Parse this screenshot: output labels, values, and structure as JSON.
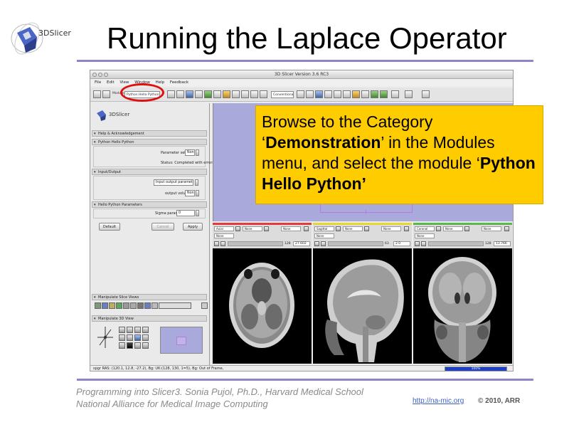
{
  "slide": {
    "title": "Running the Laplace Operator",
    "logo_text": "3DSlicer",
    "footer_line1": "Programming into Slicer3. Sonia Pujol, Ph.D., Harvard Medical School",
    "footer_line2": "National Alliance for Medical Image Computing",
    "footer_link": "http://na-mic.org",
    "footer_copyright": "© 2010, ARR"
  },
  "callout": {
    "part1": "Browse to the Category ‘",
    "bold1": "Demonstration",
    "part2": "’ in the Modules menu, and select the module ‘",
    "bold2": "Python Hello Python’"
  },
  "app": {
    "window_title": "3D Slicer Version 3.6 RC3",
    "menu": [
      "File",
      "Edit",
      "View",
      "Window",
      "Help",
      "Feedback"
    ],
    "toolbar": {
      "modules_label": "Modules",
      "module_selector_value": "Python Hello Python",
      "layout_field": "Conventional"
    },
    "left_panel": {
      "logo_text": "3DSlicer",
      "sections": {
        "help": "Help & Acknowledgement",
        "python_hello": "Python Hello Python",
        "io": "Input/Output",
        "params": "Hello Python Parameters",
        "slice_views": "Manipulate Slice Views",
        "view3d": "Manipulate 3D View"
      },
      "parameter_set_label": "Parameter set",
      "parameter_set_value": "None",
      "status_text": "Status: Completed with errors",
      "input_volume_value": "Input output parameter d",
      "output_volume_label": "output volume",
      "output_volume_value": "None",
      "sigma_label": "Sigma param",
      "sigma_value": "0",
      "buttons": {
        "default": "Default",
        "cancel": "Cancel",
        "apply": "Apply"
      }
    },
    "slices": [
      {
        "color": "#e03c3c",
        "orientation": "Axial",
        "fg": "None",
        "bg": "None",
        "label": "None",
        "slice_index": "128",
        "slice_value": "27.602"
      },
      {
        "color": "#e6d832",
        "orientation": "Sagittal",
        "fg": "None",
        "bg": "None",
        "label": "None",
        "slice_index": "63",
        "slice_value": "2.0"
      },
      {
        "color": "#5bb84a",
        "orientation": "Coronal",
        "fg": "None",
        "bg": "None",
        "label": "None",
        "slice_index": "128",
        "slice_value": "13.766"
      }
    ],
    "status_bar": "spgr RAS: (120.1, 12.8, -27.2), Bg: UK:(128, 130, 1=5), Bg: Out of Frame,",
    "progress_text": "100%",
    "progress_fraction": 1.0
  }
}
